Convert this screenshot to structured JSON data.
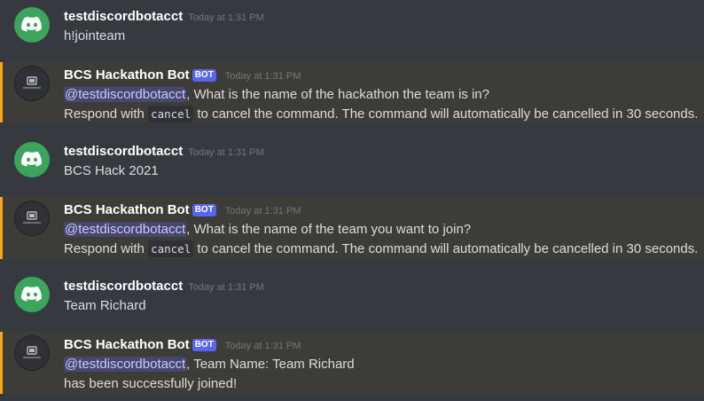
{
  "messages": [
    {
      "author": "testdiscordbotacct",
      "timestamp": "Today at 1:31 PM",
      "text": "h!jointeam"
    },
    {
      "author": "BCS Hackathon Bot",
      "bot_tag": "BOT",
      "timestamp": "Today at 1:31 PM",
      "mention": "@testdiscordbotacct",
      "line1_rest": ", What is the name of the hackathon the team is in?",
      "line2_pre": "Respond with ",
      "code": "cancel",
      "line2_post": " to cancel the command. The command will automatically be cancelled in 30 seconds."
    },
    {
      "author": "testdiscordbotacct",
      "timestamp": "Today at 1:31 PM",
      "text": "BCS Hack 2021"
    },
    {
      "author": "BCS Hackathon Bot",
      "bot_tag": "BOT",
      "timestamp": "Today at 1:31 PM",
      "mention": "@testdiscordbotacct",
      "line1_rest": ", What is the name of the team you want to join?",
      "line2_pre": "Respond with ",
      "code": "cancel",
      "line2_post": " to cancel the command. The command will automatically be cancelled in 30 seconds."
    },
    {
      "author": "testdiscordbotacct",
      "timestamp": "Today at 1:31 PM",
      "text": "Team Richard"
    },
    {
      "author": "BCS Hackathon Bot",
      "bot_tag": "BOT",
      "timestamp": "Today at 1:31 PM",
      "mention": "@testdiscordbotacct",
      "line1_rest": ", Team Name: Team Richard",
      "line2": "has been successfully joined!"
    }
  ],
  "colors": {
    "background": "#36393f",
    "mention_highlight": "#3e3c36",
    "mention_bar": "#faa61a",
    "user_avatar": "#3ba55c",
    "bot_tag": "#5865f2",
    "mention_text": "#c9cdfb"
  },
  "icons": {
    "user_avatar": "discord-logo-icon",
    "bot_avatar": "bot-avatar-icon"
  }
}
